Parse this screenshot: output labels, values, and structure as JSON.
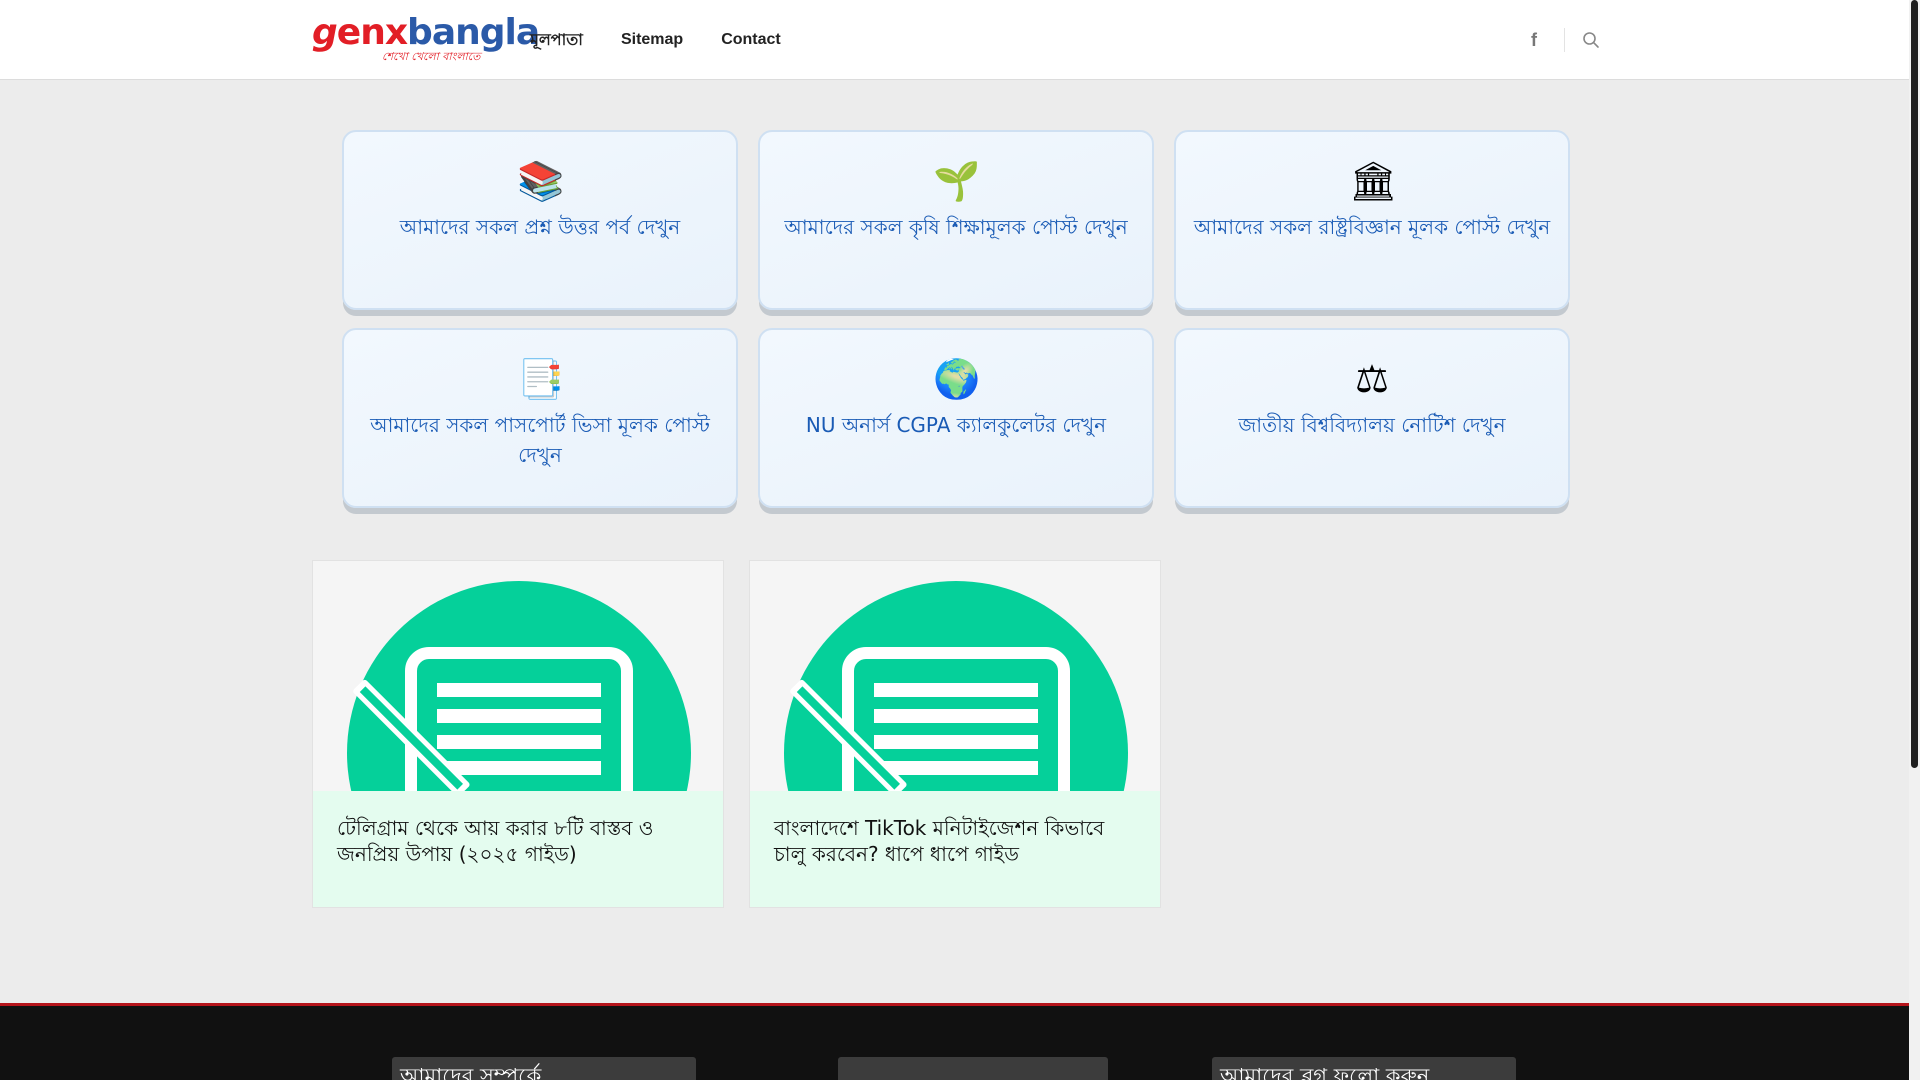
{
  "header": {
    "logo": {
      "part_g": "g",
      "part_enx": "enx",
      "part_bangla": "bangla",
      "tagline": "শেখো খেলো বাংলাতে"
    },
    "nav": [
      {
        "label": "মূলপাতা"
      },
      {
        "label": "Sitemap"
      },
      {
        "label": "Contact"
      }
    ],
    "facebook_icon": "facebook-icon",
    "facebook_glyph": "f",
    "search_icon": "search-icon"
  },
  "categories": [
    {
      "emoji": "📚",
      "icon": "books-icon",
      "label": "আমাদের সকল প্রশ্ন উত্তর পর্ব দেখুন"
    },
    {
      "emoji": "🌱",
      "icon": "seedling-icon",
      "label": "আমাদের সকল কৃষি শিক্ষামূলক পোস্ট দেখুন"
    },
    {
      "emoji": "🏛",
      "icon": "institution-icon",
      "label": "আমাদের সকল রাষ্ট্রবিজ্ঞান মূলক পোস্ট দেখুন"
    },
    {
      "emoji": "📑",
      "icon": "notepad-icon",
      "label": "আমাদের সকল পাসপোর্ট ভিসা মূলক পোস্ট দেখুন"
    },
    {
      "emoji": "🌍",
      "icon": "globe-icon",
      "label": "NU অনার্স CGPA ক্যালকুলেটর দেখুন"
    },
    {
      "emoji": "⚖",
      "icon": "scales-icon",
      "label": "জাতীয় বিশ্ববিদ্যালয় নোটিশ দেখুন"
    }
  ],
  "posts": [
    {
      "title": "টেলিগ্রাম থেকে আয় করার ৮টি বাস্তব ও জনপ্রিয় উপায় (২০২৫ গাইড)",
      "thumb_icon": "post-document-icon"
    },
    {
      "title": "বাংলাদেশে TikTok মনিটাইজেশন কিভাবে চালু করবেন? ধাপে ধাপে গাইড",
      "thumb_icon": "post-document-icon"
    }
  ],
  "footer": {
    "widgets": [
      {
        "title": "আমাদের সম্পর্কে"
      },
      {
        "title": ""
      },
      {
        "title": "আমাদের ব্লগ ফলো করুন"
      }
    ]
  },
  "colors": {
    "brand_red": "#e21e26",
    "brand_blue": "#2b5aa8",
    "category_text": "#1a5bb5",
    "thumb_green": "#05d09a",
    "post_meta_bg": "#e4fcef",
    "footer_bg": "#111111",
    "footer_accent": "#b5141b"
  }
}
